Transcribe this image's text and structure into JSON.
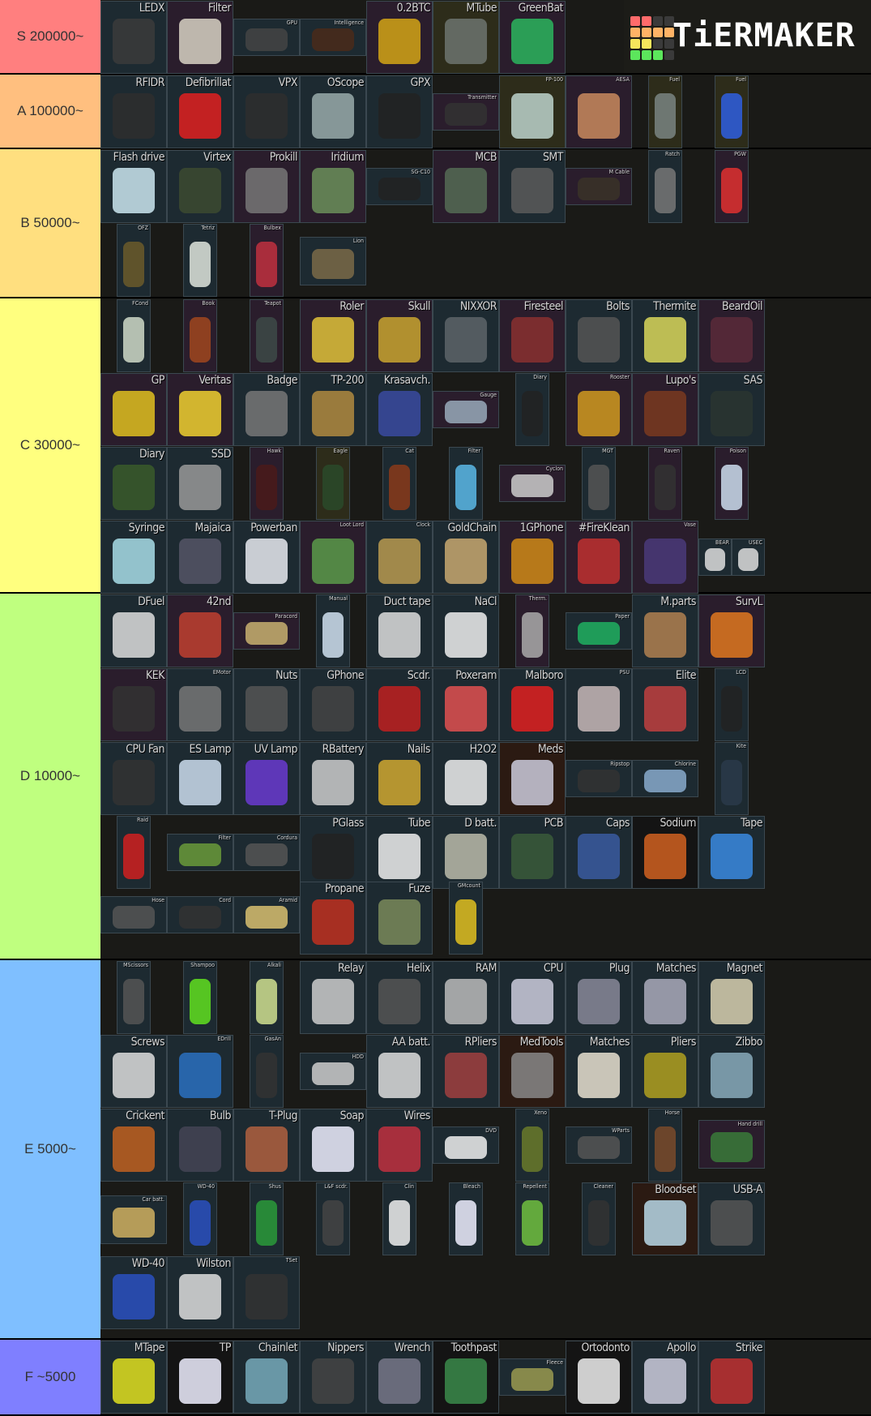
{
  "brand": {
    "name": "TiERMAKER",
    "grid_colors": [
      "#ff6b6b",
      "#ff6b6b",
      "#3a3a3a",
      "#3a3a3a",
      "#ffb366",
      "#ffb366",
      "#ffb366",
      "#ffb366",
      "#f5e65c",
      "#f5e65c",
      "#3a3a3a",
      "#3a3a3a",
      "#5ce65c",
      "#5ce65c",
      "#5ce65c",
      "#3a3a3a"
    ]
  },
  "tiers": [
    {
      "label": "S  200000~",
      "color": "#ff7f7f",
      "items": [
        {
          "label": "LEDX",
          "art": "#3b3b3b"
        },
        {
          "label": "Filter",
          "art": "#d8d2c4",
          "bg": "purple"
        },
        {
          "label": "GPU",
          "art": "#444"
        },
        {
          "label": "Intelligence",
          "art": "#4a2a1a"
        },
        {
          "label": "0.2BTC",
          "art": "#d4a516",
          "bg": "purple"
        },
        {
          "label": "MTube",
          "art": "#6d7470",
          "bg": "olive"
        },
        {
          "label": "GreenBat",
          "art": "#2bb55e",
          "bg": "purple"
        }
      ]
    },
    {
      "label": "A  100000~",
      "color": "#ffbf7f",
      "items": [
        {
          "label": "RFIDR",
          "art": "#2e2e2e"
        },
        {
          "label": "Defibrillat",
          "art": "#e02020"
        },
        {
          "label": "VPX",
          "art": "#2e2e2e"
        },
        {
          "label": "OScope",
          "art": "#9aa"
        },
        {
          "label": "GPX",
          "art": "#222"
        },
        {
          "label": "Transmitter",
          "art": "#333",
          "bg": "purple"
        },
        {
          "label": "FP-100",
          "art": "#bdd3cc",
          "bg": "olive"
        },
        {
          "label": "AESA",
          "art": "#c98a5e",
          "bg": "purple"
        },
        {
          "label": "Fuel",
          "art": "#7a8582",
          "bg": "olive"
        },
        {
          "label": "Fuel",
          "art": "#2f5fe0",
          "bg": "olive"
        }
      ]
    },
    {
      "label": "B  50000~",
      "color": "#ffdf7f",
      "items": [
        {
          "label": "Flash drive",
          "art": "#cbe6f0"
        },
        {
          "label": "Virtex",
          "art": "#3c4a30"
        },
        {
          "label": "Prokill",
          "art": "#777",
          "bg": "purple"
        },
        {
          "label": "Iridium",
          "art": "#6b8f5a",
          "bg": "purple"
        },
        {
          "label": "SG-C10",
          "art": "#222"
        },
        {
          "label": "MCB",
          "art": "#556b55",
          "bg": "purple"
        },
        {
          "label": "SMT",
          "art": "#5a5a5a"
        },
        {
          "label": "M Cable",
          "art": "#3a3228",
          "bg": "purple"
        },
        {
          "label": "Ratch",
          "art": "#777"
        },
        {
          "label": "PGW",
          "art": "#e03030",
          "bg": "purple"
        },
        {
          "label": "OFZ",
          "art": "#6b5a2a"
        },
        {
          "label": "Tetriz",
          "art": "#dfe5dd"
        },
        {
          "label": "Bulbex",
          "art": "#c03040",
          "bg": "purple"
        },
        {
          "label": "Lion",
          "art": "#7a6a48"
        }
      ]
    },
    {
      "label": "C  30000~",
      "color": "#ffff7f",
      "items": [
        {
          "label": "FCond",
          "art": "#cfd9c8"
        },
        {
          "label": "Book",
          "art": "#a0461e",
          "bg": "purple"
        },
        {
          "label": "Teapot",
          "art": "#3d4a48",
          "bg": "purple"
        },
        {
          "label": "Roler",
          "art": "#e0c23a",
          "bg": "purple"
        },
        {
          "label": "Skull",
          "art": "#c9a530",
          "bg": "purple"
        },
        {
          "label": "NIXXOR",
          "art": "#5d6469"
        },
        {
          "label": "Firesteel",
          "art": "#8a3030",
          "bg": "purple"
        },
        {
          "label": "Bolts",
          "art": "#555"
        },
        {
          "label": "Thermite",
          "art": "#d9d75a"
        },
        {
          "label": "BeardOil",
          "art": "#5a2a3a",
          "bg": "purple"
        },
        {
          "label": "GP",
          "art": "#e0c020",
          "bg": "purple"
        },
        {
          "label": "Veritas",
          "art": "#f0d030",
          "bg": "purple"
        },
        {
          "label": "Badge",
          "art": "#777"
        },
        {
          "label": "TP-200",
          "art": "#b08a40"
        },
        {
          "label": "Krasavch.",
          "art": "#3a4aa0"
        },
        {
          "label": "Gauge",
          "art": "#9ab",
          "bg": "purple"
        },
        {
          "label": "Diary",
          "art": "#222"
        },
        {
          "label": "Rooster",
          "art": "#d19a20",
          "bg": "purple"
        },
        {
          "label": "Lupo's",
          "art": "#7a3a20",
          "bg": "purple"
        },
        {
          "label": "SAS",
          "art": "#2a3530"
        },
        {
          "label": "Diary",
          "art": "#3a5a2a"
        },
        {
          "label": "SSD",
          "art": "#999"
        },
        {
          "label": "Hawk",
          "art": "#4a1a1a",
          "bg": "purple"
        },
        {
          "label": "Eagle",
          "art": "#2a4a2a",
          "bg": "olive"
        },
        {
          "label": "Cat",
          "art": "#8a3a1a"
        },
        {
          "label": "Filter",
          "art": "#5ab8e8"
        },
        {
          "label": "Cyclon",
          "art": "#ccc",
          "bg": "purple"
        },
        {
          "label": "MGT",
          "art": "#555"
        },
        {
          "label": "Raven",
          "art": "#333",
          "bg": "purple"
        },
        {
          "label": "Poison",
          "art": "#cde",
          "bg": "purple"
        },
        {
          "label": "Syringe",
          "art": "#a8dde8"
        },
        {
          "label": "Majaica",
          "art": "#556"
        },
        {
          "label": "Powerban",
          "art": "#e8eaf0"
        },
        {
          "label": "Loot Lord",
          "art": "#5a9a4a",
          "bg": "purple"
        },
        {
          "label": "Clock",
          "art": "#b89a50"
        },
        {
          "label": "GoldChain",
          "art": "#c8a870"
        },
        {
          "label": "1GPhone",
          "art": "#d08a18",
          "bg": "purple"
        },
        {
          "label": "#FireKlean",
          "art": "#c03030",
          "bg": "purple"
        },
        {
          "label": "Vase",
          "art": "#4a3a7a",
          "bg": "purple"
        },
        {
          "label": "BEAR",
          "art": "#ddd"
        },
        {
          "label": "USEC",
          "art": "#ddd"
        }
      ]
    },
    {
      "label": "D  10000~",
      "color": "#bfff7f",
      "items": [
        {
          "label": "DFuel",
          "art": "#ddd"
        },
        {
          "label": "42nd",
          "art": "#c04030",
          "bg": "purple"
        },
        {
          "label": "Paracord",
          "art": "#c8b070",
          "bg": "purple"
        },
        {
          "label": "Manual",
          "art": "#d0e0f0"
        },
        {
          "label": "Duct tape",
          "art": "#ddd"
        },
        {
          "label": "NaCl",
          "art": "#eee"
        },
        {
          "label": "Therm.",
          "art": "#aaa",
          "bg": "purple"
        },
        {
          "label": "Paper",
          "art": "#20b060"
        },
        {
          "label": "M.parts",
          "art": "#b08050"
        },
        {
          "label": "SurvL",
          "art": "#e07820",
          "bg": "purple"
        },
        {
          "label": "KEK",
          "art": "#333",
          "bg": "purple"
        },
        {
          "label": "EMotor",
          "art": "#777"
        },
        {
          "label": "Nuts",
          "art": "#555"
        },
        {
          "label": "GPhone",
          "art": "#444"
        },
        {
          "label": "Scdr.",
          "art": "#c02020"
        },
        {
          "label": "Poxeram",
          "art": "#e05050"
        },
        {
          "label": "Malboro",
          "art": "#e02020"
        },
        {
          "label": "PSU",
          "art": "#c8b8b8"
        },
        {
          "label": "Elite",
          "art": "#c04040"
        },
        {
          "label": "LCD",
          "art": "#222"
        },
        {
          "label": "CPU Fan",
          "art": "#333"
        },
        {
          "label": "ES Lamp",
          "art": "#cde"
        },
        {
          "label": "UV Lamp",
          "art": "#6a3ad0"
        },
        {
          "label": "RBattery",
          "art": "#ccc"
        },
        {
          "label": "Nails",
          "art": "#d0a830"
        },
        {
          "label": "H2O2",
          "art": "#eee"
        },
        {
          "label": "Meds",
          "art": "#ccd",
          "bg": "brown"
        },
        {
          "label": "Ripstop",
          "art": "#333"
        },
        {
          "label": "Chlorine",
          "art": "#8ac"
        },
        {
          "label": "Kite",
          "art": "#2a3a4a"
        },
        {
          "label": "Raid",
          "art": "#d02020"
        },
        {
          "label": "Filter",
          "art": "#6a9a3a"
        },
        {
          "label": "Cordura",
          "art": "#555"
        },
        {
          "label": "PGlass",
          "art": "#222"
        },
        {
          "label": "Tube",
          "art": "#eee"
        },
        {
          "label": "D batt.",
          "art": "#bba"
        },
        {
          "label": "PCB",
          "art": "#3a5a3a"
        },
        {
          "label": "Caps",
          "art": "#3a5aa0"
        },
        {
          "label": "Sodium",
          "art": "#d06020",
          "bg": "black"
        },
        {
          "label": "Tape",
          "art": "#3a8ae0"
        },
        {
          "label": "Hose",
          "art": "#555"
        },
        {
          "label": "Cord",
          "art": "#333"
        },
        {
          "label": "Aramid",
          "art": "#d8c070"
        },
        {
          "label": "Propane",
          "art": "#c03020"
        },
        {
          "label": "Fuze",
          "art": "#7a8a5a"
        },
        {
          "label": "GMcount",
          "art": "#e0c020"
        }
      ]
    },
    {
      "label": "E  5000~",
      "color": "#7fbfff",
      "items": [
        {
          "label": "MScissors",
          "art": "#555"
        },
        {
          "label": "Shampoo",
          "art": "#60e020"
        },
        {
          "label": "Alkali",
          "art": "#d0e090"
        },
        {
          "label": "Relay",
          "art": "#ccc"
        },
        {
          "label": "Helix",
          "art": "#555"
        },
        {
          "label": "RAM",
          "art": "#bbb"
        },
        {
          "label": "CPU",
          "art": "#ccd"
        },
        {
          "label": "Plug",
          "art": "#889"
        },
        {
          "label": "Matches",
          "art": "#aab"
        },
        {
          "label": "Magnet",
          "art": "#d8d0b0"
        },
        {
          "label": "Screws",
          "art": "#ddd"
        },
        {
          "label": "EDrill",
          "art": "#2a70c0"
        },
        {
          "label": "GasAn",
          "art": "#333"
        },
        {
          "label": "HDD",
          "art": "#ccc"
        },
        {
          "label": "AA batt.",
          "art": "#ddd"
        },
        {
          "label": "RPliers",
          "art": "#a04040"
        },
        {
          "label": "MedTools",
          "art": "#888",
          "bg": "brown"
        },
        {
          "label": "Matches",
          "art": "#e8e0d0"
        },
        {
          "label": "Pliers",
          "art": "#b0a020"
        },
        {
          "label": "Zibbo",
          "art": "#8ab"
        },
        {
          "label": "Crickent",
          "art": "#c06020"
        },
        {
          "label": "Bulb",
          "art": "#445"
        },
        {
          "label": "T-Plug",
          "art": "#b06040"
        },
        {
          "label": "Soap",
          "art": "#eef"
        },
        {
          "label": "Wires",
          "art": "#c03040"
        },
        {
          "label": "DVD",
          "art": "#eee"
        },
        {
          "label": "Xeno",
          "art": "#6a7a2a"
        },
        {
          "label": "WParts",
          "art": "#555"
        },
        {
          "label": "Horse",
          "art": "#7a4a2a"
        },
        {
          "label": "Hand drill",
          "art": "#3a7a3a",
          "bg": "purple"
        },
        {
          "label": "Car batt.",
          "art": "#d0b060"
        },
        {
          "label": "WD-40",
          "art": "#2a50c0"
        },
        {
          "label": "Shus",
          "art": "#2a9a3a"
        },
        {
          "label": "L&F scdr.",
          "art": "#444"
        },
        {
          "label": "Clin",
          "art": "#eee"
        },
        {
          "label": "Bleach",
          "art": "#eef"
        },
        {
          "label": "Repellent",
          "art": "#70c040"
        },
        {
          "label": "Cleaner",
          "art": "#333"
        },
        {
          "label": "Bloodset",
          "art": "#b8d8e8",
          "bg": "brown"
        },
        {
          "label": "USB-A",
          "art": "#555"
        },
        {
          "label": "WD-40",
          "art": "#2a50c0"
        },
        {
          "label": "Wilston",
          "art": "#ddd"
        },
        {
          "label": "TSet",
          "art": "#333"
        }
      ]
    },
    {
      "label": "F  ~5000",
      "color": "#7f7fff",
      "items": [
        {
          "label": "MTape",
          "art": "#e0e020"
        },
        {
          "label": "TP",
          "art": "#eef",
          "bg": "black"
        },
        {
          "label": "Chainlet",
          "art": "#7ab"
        },
        {
          "label": "Nippers",
          "art": "#444"
        },
        {
          "label": "Wrench",
          "art": "#778"
        },
        {
          "label": "Toothpast",
          "art": "#3a8a4a",
          "bg": "black"
        },
        {
          "label": "Fleece",
          "art": "#9a9a50"
        },
        {
          "label": "Ortodonto",
          "art": "#eee",
          "bg": "black"
        },
        {
          "label": "Apollo",
          "art": "#ccd"
        },
        {
          "label": "Strike",
          "art": "#c03030"
        }
      ]
    }
  ]
}
